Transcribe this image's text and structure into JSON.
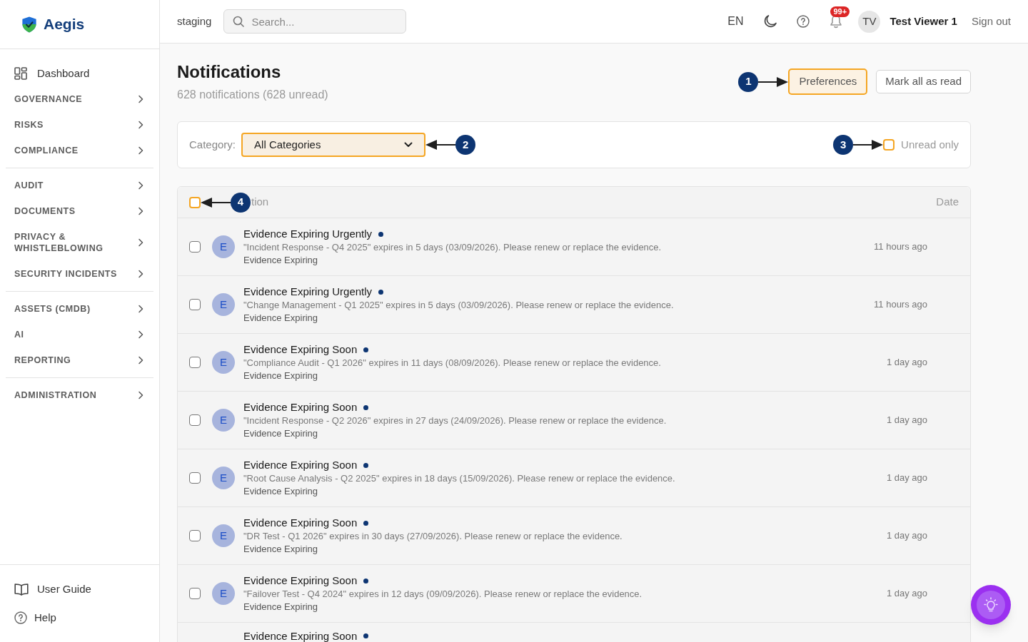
{
  "topbar": {
    "environment": "staging",
    "search": {
      "placeholder": "Search..."
    },
    "language": "EN",
    "notifications_badge": "99+",
    "user": {
      "initials": "TV",
      "name": "Test Viewer 1"
    },
    "sign_out": "Sign out"
  },
  "sidebar": {
    "logo": "Aegis",
    "groups": [
      [
        {
          "kind": "link",
          "label": "Dashboard"
        },
        {
          "kind": "section",
          "label": "GOVERNANCE",
          "expanded": false
        },
        {
          "kind": "section",
          "label": "RISKS",
          "expanded": false
        },
        {
          "kind": "section",
          "label": "COMPLIANCE",
          "expanded": false
        }
      ],
      [
        {
          "kind": "section",
          "label": "AUDIT",
          "expanded": false
        },
        {
          "kind": "section",
          "label": "DOCUMENTS",
          "expanded": false
        },
        {
          "kind": "section",
          "label": "PRIVACY & WHISTLEBLOWING",
          "expanded": false
        },
        {
          "kind": "section",
          "label": "SECURITY INCIDENTS",
          "expanded": false
        }
      ],
      [
        {
          "kind": "section",
          "label": "ASSETS (CMDB)",
          "expanded": false
        },
        {
          "kind": "section",
          "label": "AI",
          "expanded": false
        },
        {
          "kind": "section",
          "label": "REPORTING",
          "expanded": false
        }
      ],
      [
        {
          "kind": "section",
          "label": "ADMINISTRATION",
          "expanded": false
        }
      ]
    ],
    "footer": [
      {
        "kind": "guide",
        "label": "User Guide"
      },
      {
        "kind": "help",
        "label": "Help"
      }
    ]
  },
  "page": {
    "title": "Notifications",
    "subtitle": "628 notifications (628 unread)",
    "actions": [
      {
        "label": "Preferences",
        "callout": "1"
      },
      {
        "label": "Mark all as read"
      }
    ]
  },
  "filters": {
    "category": {
      "label": "Category:",
      "value": "All Categories",
      "callout": "2"
    },
    "unread_only": {
      "label": "Unread only",
      "checked": false,
      "callout": "3"
    }
  },
  "table": {
    "select_all": {
      "checked": false,
      "callout": "4"
    },
    "columns": [
      {
        "label": "tion"
      },
      {
        "label": "Date"
      }
    ],
    "rows": [
      {
        "checked": false,
        "avatar": "E",
        "title": "Evidence Expiring Urgently",
        "unread": true,
        "message": "\"Incident Response - Q4 2025\" expires in 5 days (03/09/2026). Please renew or replace the evidence.",
        "category": "Evidence Expiring",
        "time": "11 hours ago"
      },
      {
        "checked": false,
        "avatar": "E",
        "title": "Evidence Expiring Urgently",
        "unread": true,
        "message": "\"Change Management - Q1 2025\" expires in 5 days (03/09/2026). Please renew or replace the evidence.",
        "category": "Evidence Expiring",
        "time": "11 hours ago"
      },
      {
        "checked": false,
        "avatar": "E",
        "title": "Evidence Expiring Soon",
        "unread": true,
        "message": "\"Compliance Audit - Q1 2026\" expires in 11 days (08/09/2026). Please renew or replace the evidence.",
        "category": "Evidence Expiring",
        "time": "1 day ago"
      },
      {
        "checked": false,
        "avatar": "E",
        "title": "Evidence Expiring Soon",
        "unread": true,
        "message": "\"Incident Response - Q2 2026\" expires in 27 days (24/09/2026). Please renew or replace the evidence.",
        "category": "Evidence Expiring",
        "time": "1 day ago"
      },
      {
        "checked": false,
        "avatar": "E",
        "title": "Evidence Expiring Soon",
        "unread": true,
        "message": "\"Root Cause Analysis - Q2 2025\" expires in 18 days (15/09/2026). Please renew or replace the evidence.",
        "category": "Evidence Expiring",
        "time": "1 day ago"
      },
      {
        "checked": false,
        "avatar": "E",
        "title": "Evidence Expiring Soon",
        "unread": true,
        "message": "\"DR Test - Q1 2026\" expires in 30 days (27/09/2026). Please renew or replace the evidence.",
        "category": "Evidence Expiring",
        "time": "1 day ago"
      },
      {
        "checked": false,
        "avatar": "E",
        "title": "Evidence Expiring Soon",
        "unread": true,
        "message": "\"Failover Test - Q4 2024\" expires in 12 days (09/09/2026). Please renew or replace the evidence.",
        "category": "Evidence Expiring",
        "time": "1 day ago"
      },
      {
        "title": "Evidence Expiring Soon",
        "unread": true
      }
    ]
  }
}
